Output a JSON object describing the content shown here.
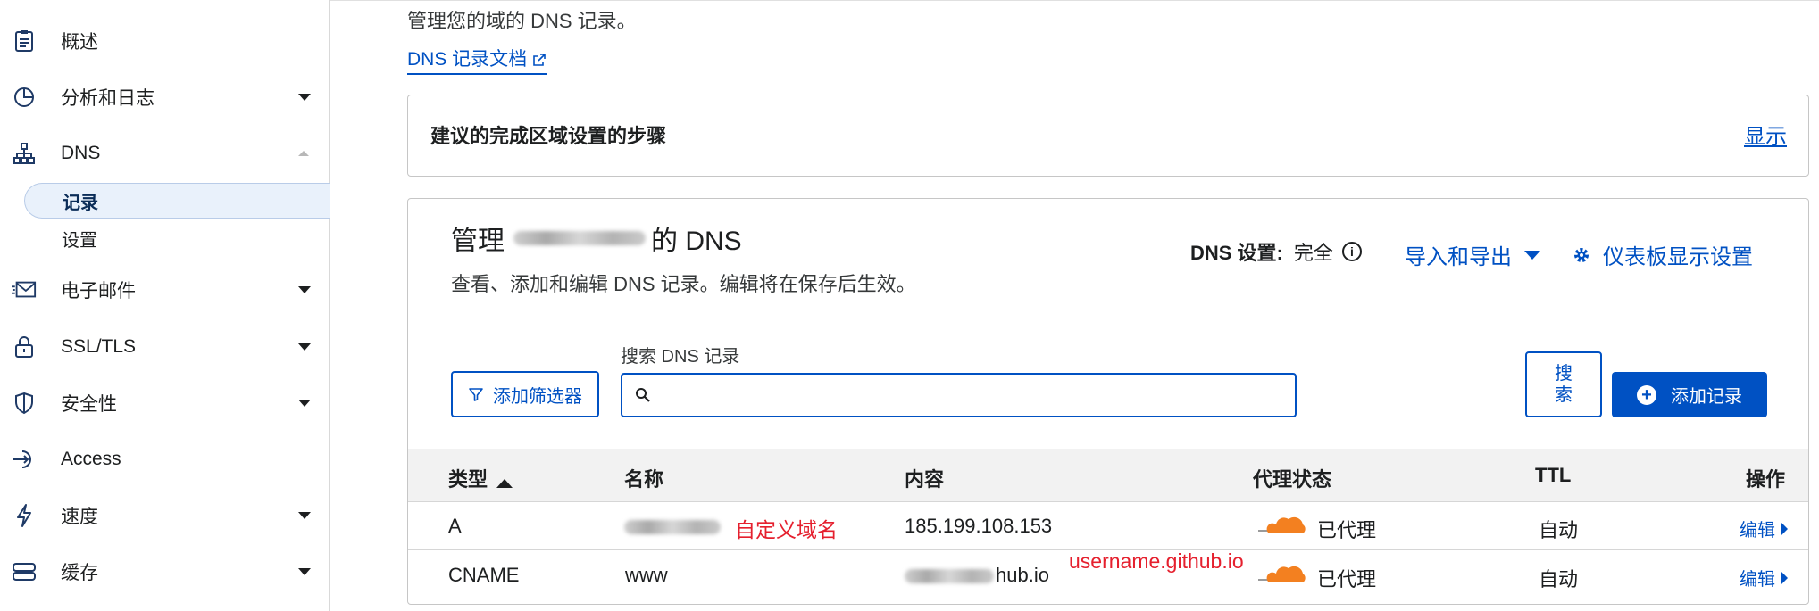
{
  "sidebar": {
    "items": [
      {
        "label": "概述",
        "icon": "clipboard-icon"
      },
      {
        "label": "分析和日志",
        "icon": "pie-chart-icon"
      },
      {
        "label": "DNS",
        "icon": "sitemap-icon"
      },
      {
        "label": "电子邮件",
        "icon": "email-icon"
      },
      {
        "label": "SSL/TLS",
        "icon": "lock-icon"
      },
      {
        "label": "安全性",
        "icon": "shield-icon"
      },
      {
        "label": "Access",
        "icon": "access-icon"
      },
      {
        "label": "速度",
        "icon": "lightning-icon"
      },
      {
        "label": "缓存",
        "icon": "cache-icon"
      }
    ],
    "dns_sub": [
      {
        "label": "记录",
        "active": true
      },
      {
        "label": "设置",
        "active": false
      }
    ]
  },
  "main": {
    "intro": "管理您的域的 DNS 记录。",
    "doc_link": "DNS 记录文档",
    "steps_title": "建议的完成区域设置的步骤",
    "steps_show": "显示",
    "dns_title_prefix": "管理",
    "dns_title_suffix": "的 DNS",
    "dns_subtitle": "查看、添加和编辑 DNS 记录。编辑将在保存后生效。",
    "dns_settings_label": "DNS 设置:",
    "dns_settings_value": "完全",
    "import_export": "导入和导出",
    "dashboard_settings": "仪表板显示设置",
    "filter_button": "添加筛选器",
    "search_label": "搜索 DNS 记录",
    "search_value": "",
    "search_button": "搜索",
    "add_record_button": "添加记录"
  },
  "table": {
    "headers": {
      "type": "类型",
      "name": "名称",
      "content": "内容",
      "proxy": "代理状态",
      "ttl": "TTL",
      "actions": "操作"
    },
    "rows": [
      {
        "type": "A",
        "name": "",
        "name_note": "自定义域名",
        "content": "185.199.108.153",
        "content_note": "",
        "proxy": "已代理",
        "ttl": "自动",
        "action": "编辑"
      },
      {
        "type": "CNAME",
        "name": "www",
        "name_note": "",
        "content": "hub.io",
        "content_note": "username.github.io",
        "proxy": "已代理",
        "ttl": "自动",
        "action": "编辑"
      }
    ]
  },
  "colors": {
    "accent": "#0051c3",
    "cloud": "#f38020",
    "annotation": "#e5202e"
  }
}
